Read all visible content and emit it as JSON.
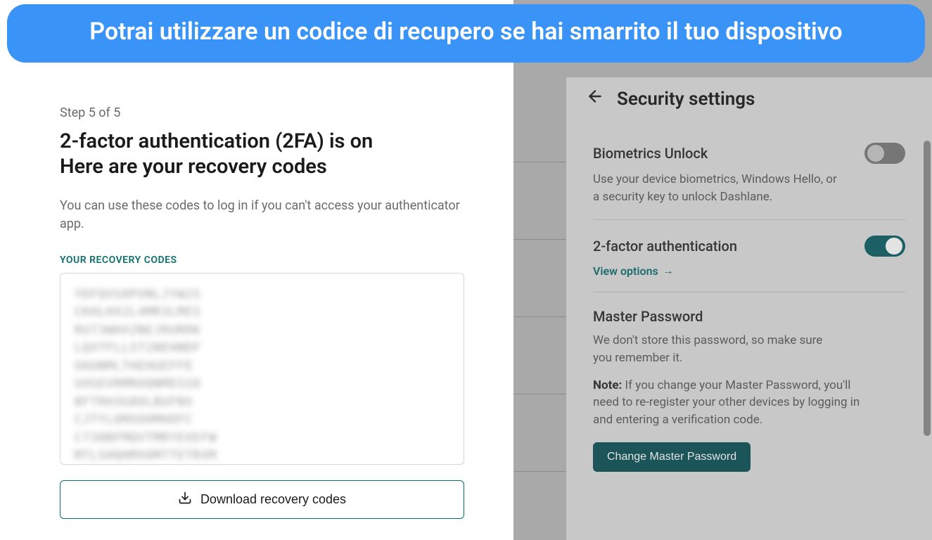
{
  "banner": {
    "text": "Potrai utilizzare un codice di recupero se hai smarrito il tuo dispositivo"
  },
  "left": {
    "step": "Step 5 of 5",
    "title_line1": "2-factor authentication (2FA) is on",
    "title_line2": "Here are your recovery codes",
    "description": "You can use these codes to log in if you can't access your authenticator app.",
    "codes_label": "YOUR RECOVERY CODES",
    "download_label": "Download recovery codes"
  },
  "right": {
    "header": "Security settings",
    "biometrics": {
      "title": "Biometrics Unlock",
      "desc": "Use your device biometrics, Windows Hello, or a security key to unlock Dashlane.",
      "enabled": false
    },
    "twofa": {
      "title": "2-factor authentication",
      "link": "View options",
      "enabled": true
    },
    "master": {
      "title": "Master Password",
      "desc": "We don't store this password, so make sure you remember it.",
      "note_label": "Note:",
      "note_text": " If you change your Master Password, you'll need to re-register your other devices by logging in and entering a verification code.",
      "button": "Change Master Password"
    }
  }
}
